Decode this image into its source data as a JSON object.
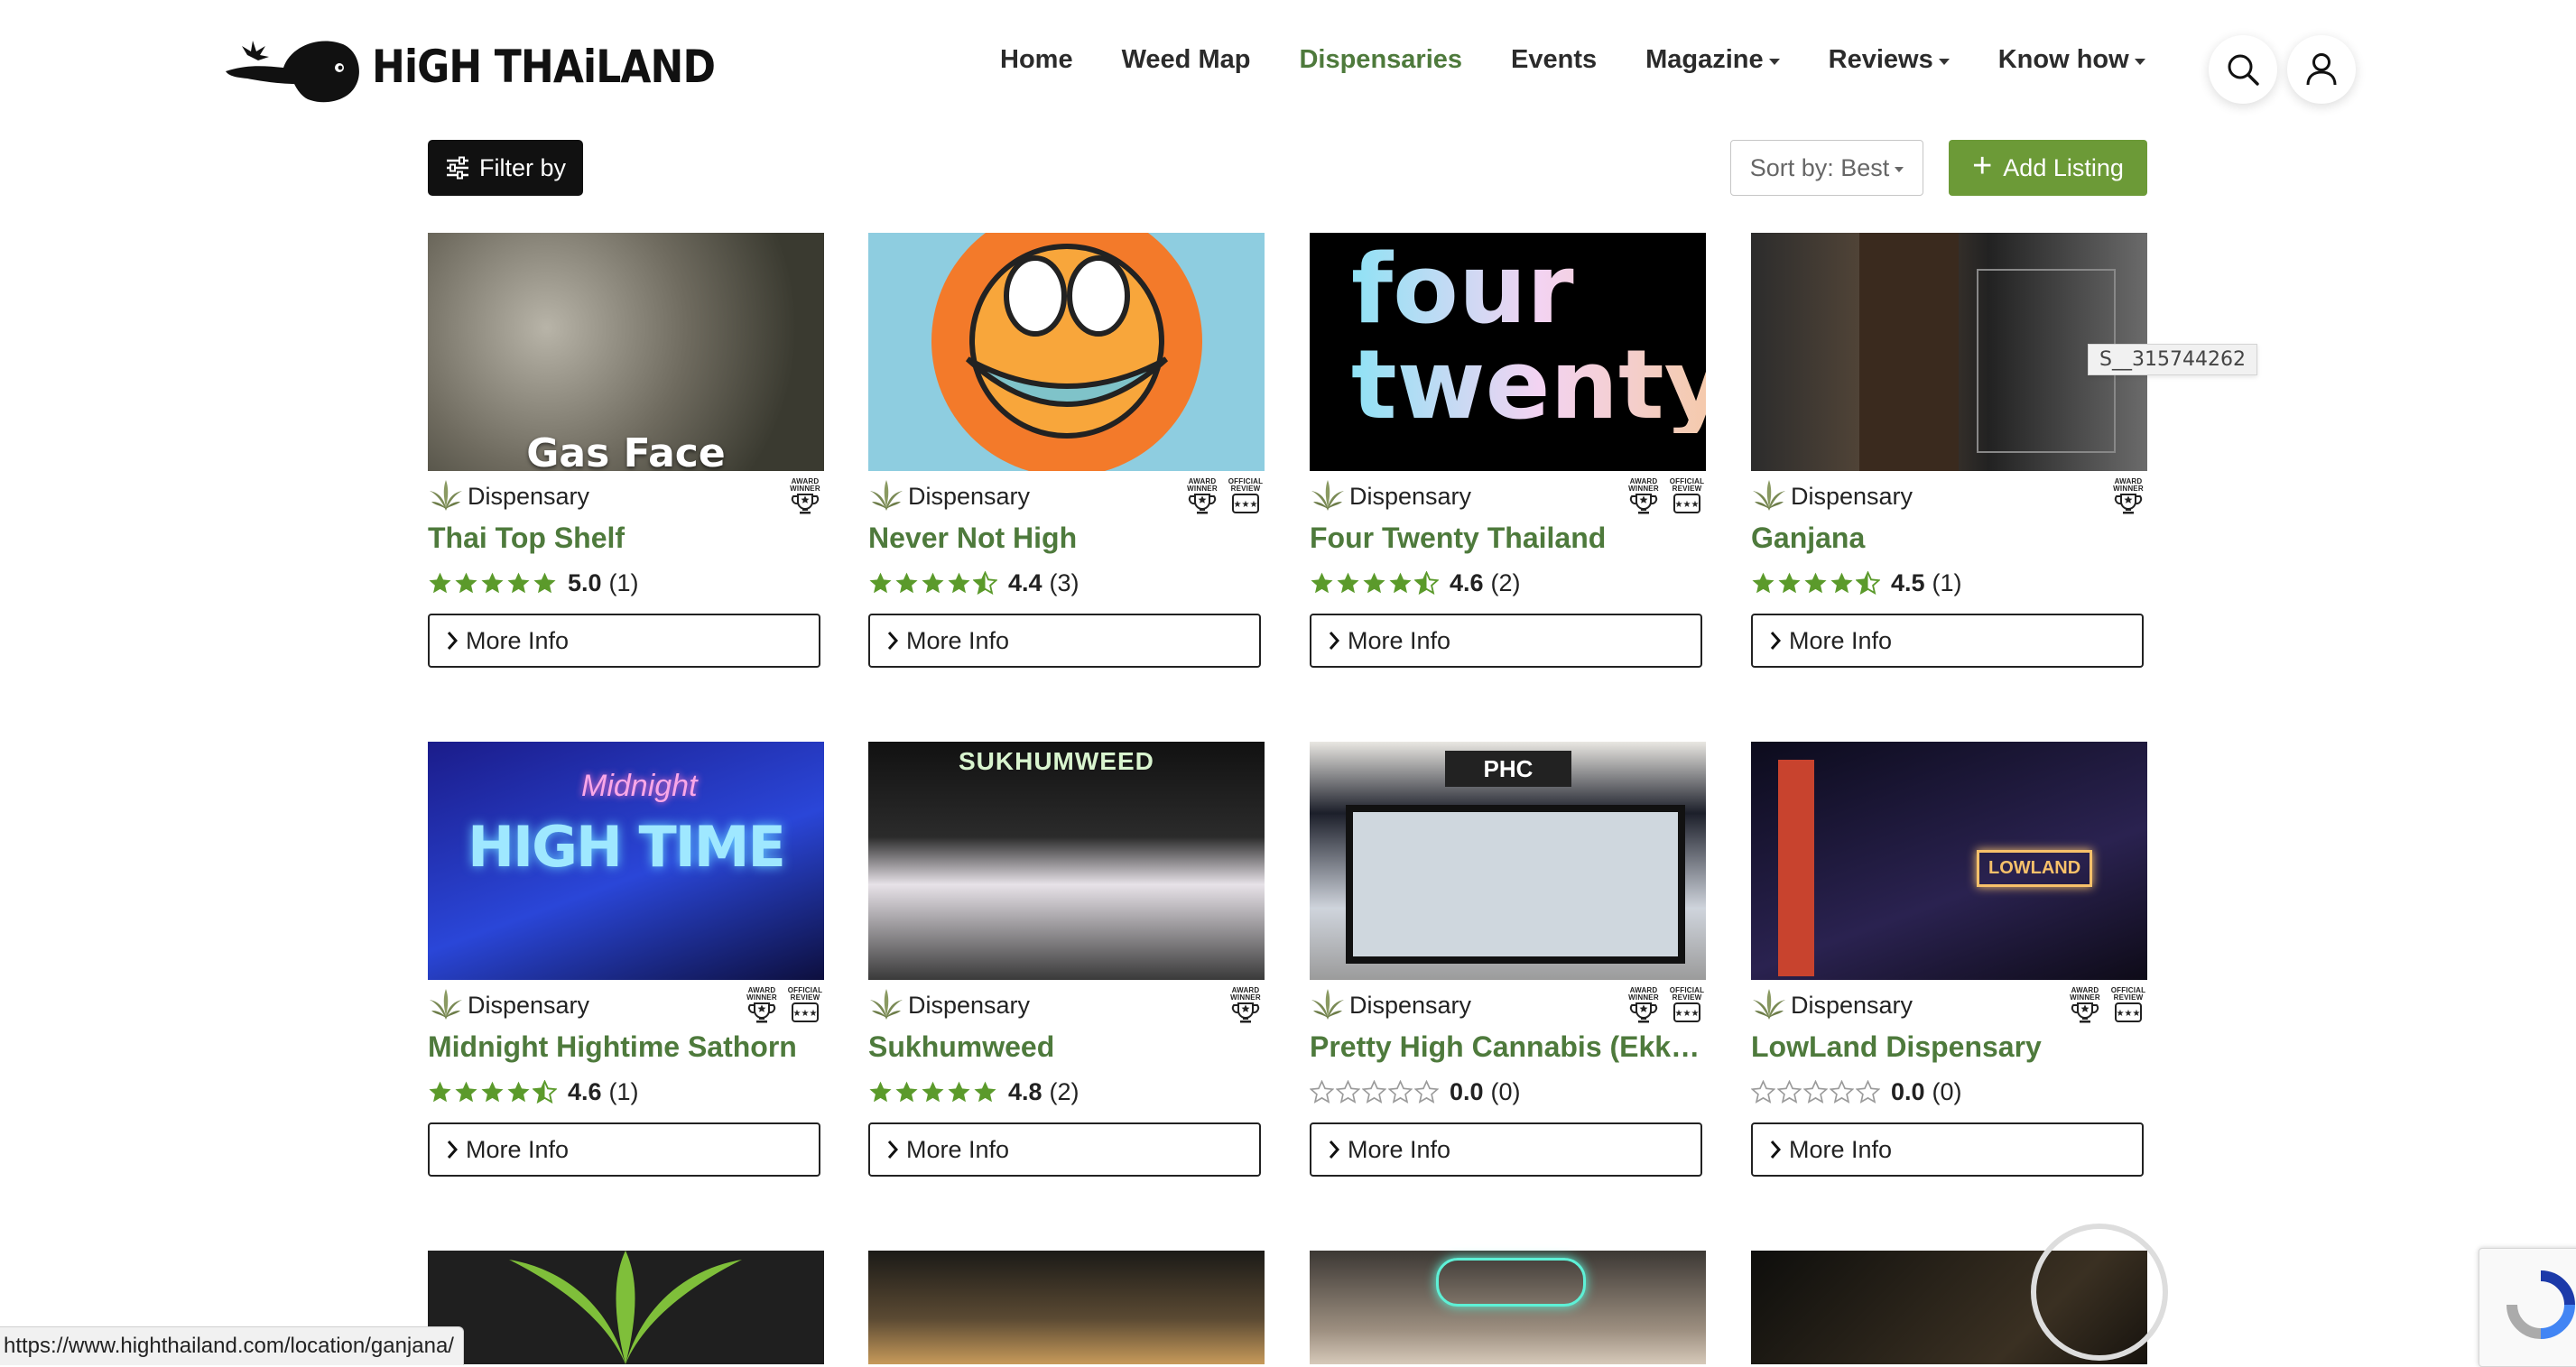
{
  "header": {
    "brand": "HiGH THAiLAND",
    "nav": [
      {
        "label": "Home",
        "dropdown": false,
        "active": false
      },
      {
        "label": "Weed Map",
        "dropdown": false,
        "active": false
      },
      {
        "label": "Dispensaries",
        "dropdown": false,
        "active": true
      },
      {
        "label": "Events",
        "dropdown": false,
        "active": false
      },
      {
        "label": "Magazine",
        "dropdown": true,
        "active": false
      },
      {
        "label": "Reviews",
        "dropdown": true,
        "active": false
      },
      {
        "label": "Know how",
        "dropdown": true,
        "active": false
      }
    ],
    "search_icon": "search-icon",
    "account_icon": "user-icon"
  },
  "toolbar": {
    "filter_label": "Filter by",
    "sort_label": "Sort by: Best",
    "add_label": "Add Listing"
  },
  "colors": {
    "brand_green": "#4e7a3c",
    "star_green": "#5b9a2b",
    "add_button": "#6c9a37"
  },
  "listings": [
    {
      "category": "Dispensary",
      "title": "Thai Top Shelf",
      "rating": 5.0,
      "score": "5.0",
      "count": "(1)",
      "more": "More Info",
      "badges": [
        "award"
      ],
      "image_text": "Gas Face"
    },
    {
      "category": "Dispensary",
      "title": "Never Not High",
      "rating": 4.4,
      "score": "4.4",
      "count": "(3)",
      "more": "More Info",
      "badges": [
        "award",
        "official"
      ],
      "image_text": ""
    },
    {
      "category": "Dispensary",
      "title": "Four Twenty Thailand",
      "rating": 4.6,
      "score": "4.6",
      "count": "(2)",
      "more": "More Info",
      "badges": [
        "award",
        "official"
      ],
      "image_text": "four twenty"
    },
    {
      "category": "Dispensary",
      "title": "Ganjana",
      "rating": 4.5,
      "score": "4.5",
      "count": "(1)",
      "more": "More Info",
      "badges": [
        "award"
      ],
      "image_text": ""
    },
    {
      "category": "Dispensary",
      "title": "Midnight Hightime Sathorn",
      "rating": 4.6,
      "score": "4.6",
      "count": "(1)",
      "more": "More Info",
      "badges": [
        "award",
        "official"
      ],
      "image_text": "HIGH TIME"
    },
    {
      "category": "Dispensary",
      "title": "Sukhumweed",
      "rating": 4.8,
      "score": "4.8",
      "count": "(2)",
      "more": "More Info",
      "badges": [
        "award"
      ],
      "image_text": "SUKHUMWEED"
    },
    {
      "category": "Dispensary",
      "title": "Pretty High Cannabis (Ekkamai)",
      "rating": 0.0,
      "score": "0.0",
      "count": "(0)",
      "more": "More Info",
      "badges": [
        "award",
        "official"
      ],
      "image_text": "PHC"
    },
    {
      "category": "Dispensary",
      "title": "LowLand Dispensary",
      "rating": 0.0,
      "score": "0.0",
      "count": "(0)",
      "more": "More Info",
      "badges": [
        "award",
        "official"
      ],
      "image_text": "LOWLAND"
    }
  ],
  "badge_labels": {
    "award": [
      "AWARD",
      "WINNER"
    ],
    "official": [
      "OFFICIAL",
      "REVIEW"
    ]
  },
  "tooltip": "S__315744262",
  "status_url": "https://www.highthailand.com/location/ganjana/"
}
